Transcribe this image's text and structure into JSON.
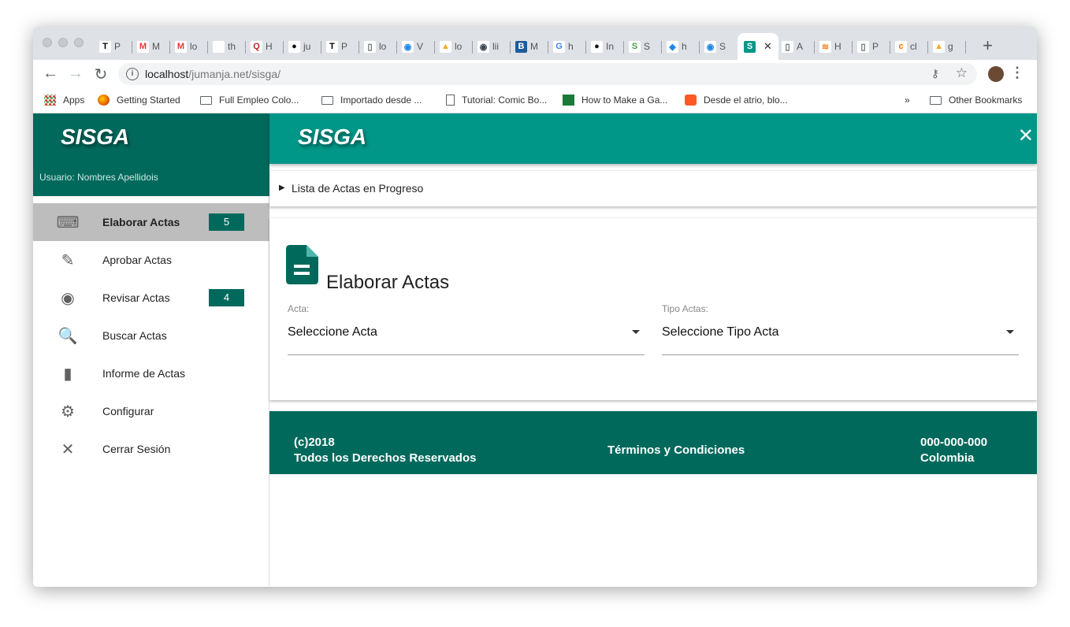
{
  "browser": {
    "tabs": [
      {
        "icon": "T",
        "label": "P",
        "bg": "#ffffff",
        "fg": "#000000"
      },
      {
        "icon": "M",
        "label": "M",
        "bg": "#ffffff",
        "fg": "#e53935"
      },
      {
        "icon": "M",
        "label": "lo",
        "bg": "#ffffff",
        "fg": "#e53935"
      },
      {
        "icon": "",
        "label": "th",
        "bg": "#ffffff",
        "fg": "#000000"
      },
      {
        "icon": "Q",
        "label": "H",
        "bg": "#ffffff",
        "fg": "#b92b27"
      },
      {
        "icon": "●",
        "label": "ju",
        "bg": "#ffffff",
        "fg": "#111111"
      },
      {
        "icon": "T",
        "label": "P",
        "bg": "#ffffff",
        "fg": "#000000"
      },
      {
        "icon": "▯",
        "label": "lo",
        "bg": "#ffffff",
        "fg": "#5f6368"
      },
      {
        "icon": "◉",
        "label": "V",
        "bg": "#ffffff",
        "fg": "#1e88e5"
      },
      {
        "icon": "▲",
        "label": "lo",
        "bg": "#ffffff",
        "fg": "#f9a825"
      },
      {
        "icon": "◉",
        "label": "lii",
        "bg": "#ffffff",
        "fg": "#37474f"
      },
      {
        "icon": "B",
        "label": "M",
        "bg": "#1d5b9c",
        "fg": "#ffffff"
      },
      {
        "icon": "G",
        "label": "h",
        "bg": "#ffffff",
        "fg": "#4285f4"
      },
      {
        "icon": "●",
        "label": "In",
        "bg": "#ffffff",
        "fg": "#111111"
      },
      {
        "icon": "S",
        "label": "S",
        "bg": "#ffffff",
        "fg": "#43a047"
      },
      {
        "icon": "◆",
        "label": "h",
        "bg": "#ffffff",
        "fg": "#1e88e5"
      },
      {
        "icon": "◉",
        "label": "S",
        "bg": "#ffffff",
        "fg": "#1e88e5"
      },
      {
        "icon": "S",
        "label": "",
        "bg": "#009688",
        "fg": "#ffffff",
        "active": true
      },
      {
        "icon": "▯",
        "label": "A",
        "bg": "#ffffff",
        "fg": "#5f6368"
      },
      {
        "icon": "≋",
        "label": "H",
        "bg": "#ffffff",
        "fg": "#f48024"
      },
      {
        "icon": "▯",
        "label": "P",
        "bg": "#ffffff",
        "fg": "#5f6368"
      },
      {
        "icon": "c",
        "label": "cl",
        "bg": "#ffffff",
        "fg": "#ff6d00"
      },
      {
        "icon": "▲",
        "label": "g",
        "bg": "#ffffff",
        "fg": "#f9a825"
      }
    ],
    "url_host": "localhost",
    "url_path": "/jumanja.net/sisga/",
    "bookmarks": {
      "apps": "Apps",
      "getting_started": "Getting Started",
      "full_empleo": "Full Empleo Colo...",
      "importado": "Importado desde ...",
      "tutorial": "Tutorial: Comic Bo...",
      "how_to": "How to Make a Ga...",
      "desde_atrio": "Desde el atrio, blo...",
      "overflow": "»",
      "other": "Other Bookmarks"
    }
  },
  "sidebar": {
    "brand": "SISGA",
    "user": "Usuario: Nombres Apellidois",
    "items": [
      {
        "label": "Elaborar Actas",
        "icon": "keyboard-icon",
        "glyph": "⌨",
        "badge": "5",
        "active": true
      },
      {
        "label": "Aprobar Actas",
        "icon": "edit-icon",
        "glyph": "✎",
        "badge": null,
        "active": false
      },
      {
        "label": "Revisar Actas",
        "icon": "eye-icon",
        "glyph": "◉",
        "badge": "4",
        "active": false
      },
      {
        "label": "Buscar Actas",
        "icon": "find-in-page-icon",
        "glyph": "🔍",
        "badge": null,
        "active": false
      },
      {
        "label": "Informe de Actas",
        "icon": "bar-chart-icon",
        "glyph": "▮",
        "badge": null,
        "active": false
      },
      {
        "label": "Configurar",
        "icon": "gear-icon",
        "glyph": "⚙",
        "badge": null,
        "active": false
      },
      {
        "label": "Cerrar Sesión",
        "icon": "close-icon",
        "glyph": "✕",
        "badge": null,
        "active": false
      }
    ]
  },
  "header": {
    "brand": "SISGA",
    "close": "✕"
  },
  "progress_list": {
    "toggle": "▶",
    "label": "Lista de Actas en Progreso"
  },
  "form": {
    "title": "Elaborar Actas",
    "acta_label": "Acta:",
    "acta_value": "Seleccione Acta",
    "tipo_label": "Tipo Actas:",
    "tipo_value": "Seleccione Tipo Acta"
  },
  "footer": {
    "copyright_line1": "(c)2018",
    "copyright_line2": "Todos los Derechos Reservados",
    "terms": "Términos y Condiciones",
    "phone": "000-000-000",
    "country": "Colombia"
  },
  "colors": {
    "primary_dark": "#00695c",
    "primary": "#009688",
    "active_item": "#bdbdbd"
  }
}
